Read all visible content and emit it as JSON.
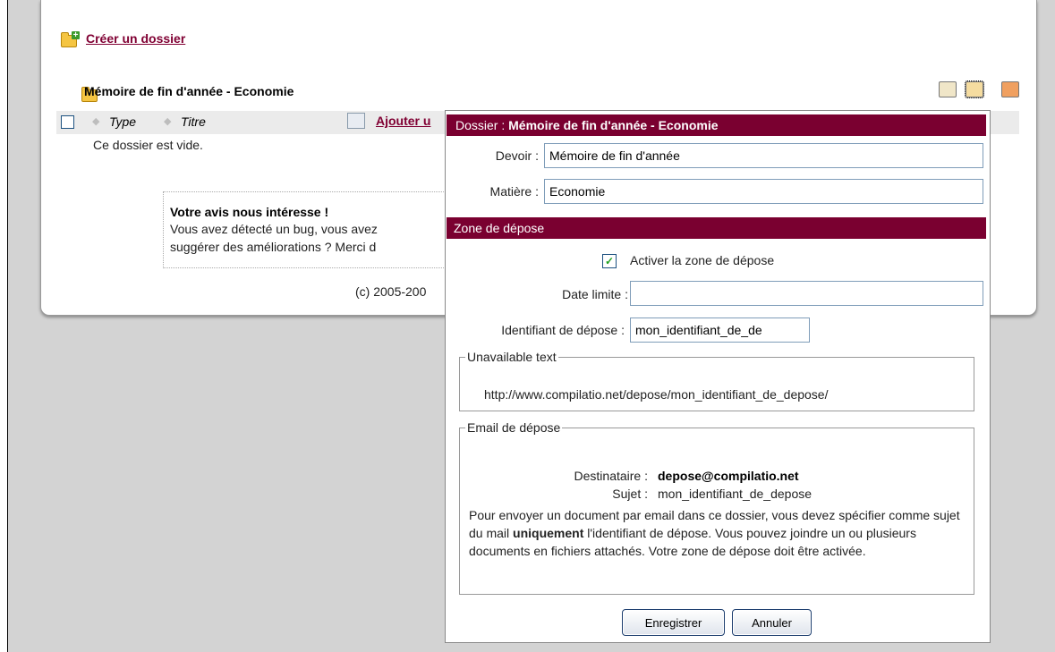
{
  "page": {
    "create_folder_label": "Créer un dossier",
    "folder_title": "Mémoire de fin d'année - Economie",
    "list_header": {
      "type_label": "Type",
      "title_label": "Titre",
      "add_label": "Ajouter u"
    },
    "empty_text": "Ce dossier est vide.",
    "feedback": {
      "title": "Votre avis nous intéresse !",
      "line1": "Vous avez détecté un bug, vous avez",
      "line2": "suggérer des améliorations ? Merci d"
    },
    "copyright": "(c) 2005-200"
  },
  "toolbar_icons": [
    "add-document-icon",
    "folder-properties-icon",
    "delete-folder-icon"
  ],
  "dialog": {
    "header_prefix": "Dossier : ",
    "header_name": "Mémoire de fin d'année - Economie",
    "devoir_label": "Devoir :",
    "devoir_value": "Mémoire de fin d'année",
    "matiere_label": "Matière :",
    "matiere_value": "Economie",
    "zone_title": "Zone de dépose",
    "activate_label": "Activer la zone de dépose",
    "activate_checked": true,
    "date_label": "Date limite :",
    "date_value": "",
    "identifier_label": "Identifiant de dépose :",
    "identifier_value": "mon_identifiant_de_de",
    "url_legend": "Unavailable text",
    "url_text": "http://www.compilatio.net/depose/mon_identifiant_de_depose/",
    "email_legend": "Email de dépose",
    "recipient_label": "Destinataire :",
    "recipient_value": "depose@compilatio.net",
    "subject_label": "Sujet :",
    "subject_value": "mon_identifiant_de_depose",
    "help_part1": "Pour envoyer un document par email dans ce dossier, vous devez spécifier comme sujet du mail ",
    "help_bold": "uniquement",
    "help_part2": " l'identifiant de dépose. Vous pouvez joindre un ou plusieurs documents en fichiers attachés. Votre zone de dépose doit être activée.",
    "save_label": "Enregistrer",
    "cancel_label": "Annuler"
  },
  "colors": {
    "accent": "#7a0030",
    "link": "#800033",
    "background": "#d3d3d3"
  }
}
